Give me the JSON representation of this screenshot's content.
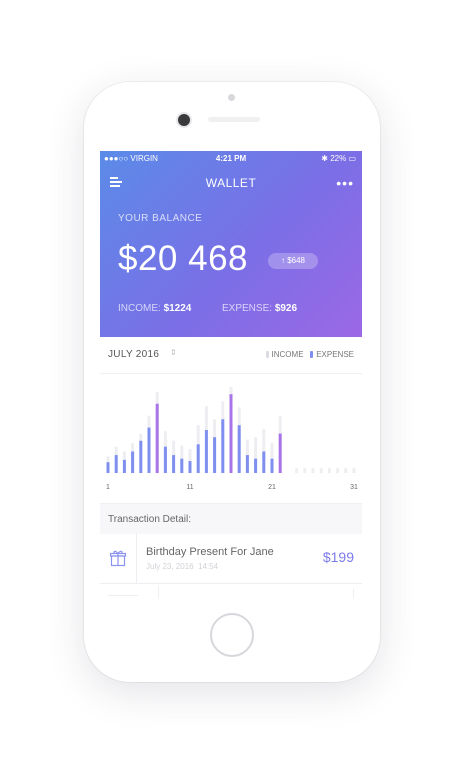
{
  "status_bar": {
    "carrier": "●●●○○ VIRGIN",
    "time": "4:21 PM",
    "battery": "✱ 22% ▭"
  },
  "nav": {
    "title": "WALLET",
    "menu_icon": "menu-icon",
    "more_icon": "more-icon",
    "more_glyph": "•••"
  },
  "balance": {
    "label": "YOUR BALANCE",
    "amount": "$20 468",
    "change": "↑ $648"
  },
  "summary": {
    "income_label": "INCOME:",
    "income_value": "$1224",
    "expense_label": "EXPENSE:",
    "expense_value": "$926"
  },
  "month": {
    "label": "JULY 2016",
    "chevron": "⇕"
  },
  "legend": {
    "income": "INCOME",
    "expense": "EXPENSE"
  },
  "colors": {
    "income_bar": "#eeeef2",
    "expense_bar": "#7f8ff0",
    "expense_highlight": "#a874e8",
    "accent": "#7b7bea"
  },
  "chart_data": {
    "type": "bar",
    "categories": [
      "1",
      "2",
      "3",
      "4",
      "5",
      "6",
      "7",
      "8",
      "9",
      "10",
      "11",
      "12",
      "13",
      "14",
      "15",
      "16",
      "17",
      "18",
      "19",
      "20",
      "21",
      "22",
      "23",
      "24",
      "25",
      "26",
      "27",
      "28",
      "29",
      "30",
      "31"
    ],
    "x_tick_labels": [
      "1",
      "11",
      "21",
      "31"
    ],
    "series": [
      {
        "name": "INCOME",
        "values": [
          14,
          22,
          18,
          25,
          33,
          48,
          68,
          35,
          27,
          23,
          20,
          40,
          56,
          45,
          60,
          72,
          55,
          28,
          30,
          37,
          25,
          48,
          0,
          4,
          4,
          4,
          4,
          4,
          4,
          4,
          4
        ]
      },
      {
        "name": "EXPENSE",
        "values": [
          9,
          15,
          11,
          18,
          27,
          38,
          58,
          22,
          15,
          12,
          10,
          24,
          36,
          30,
          45,
          66,
          40,
          15,
          12,
          18,
          12,
          33,
          0,
          0,
          0,
          0,
          0,
          0,
          0,
          0,
          0
        ]
      }
    ],
    "highlight_days": [
      "7",
      "16",
      "22"
    ]
  },
  "transactions": {
    "section_label": "Transaction Detail:",
    "items": [
      {
        "icon": "gift-icon",
        "title": "Birthday Present For Jane",
        "date": "July 23, 2016",
        "time": "14:54",
        "amount": "$199"
      }
    ]
  }
}
